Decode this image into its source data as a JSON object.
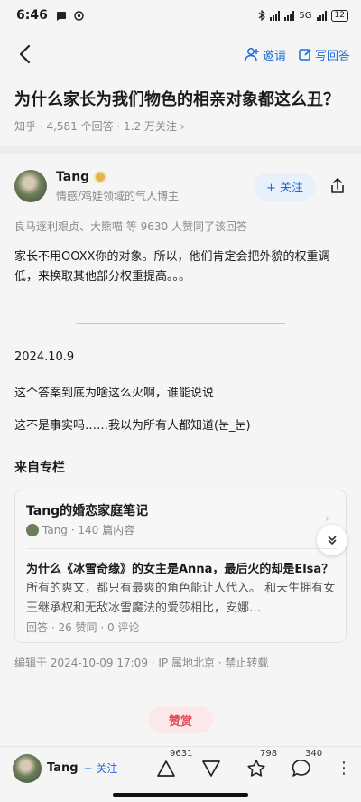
{
  "status_bar": {
    "time": "6:46",
    "network": "5G",
    "battery": "12"
  },
  "nav": {
    "invite_label": "邀请",
    "write_answer_label": "写回答"
  },
  "question": {
    "title": "为什么家长为我们物色的相亲对象都这么丑？",
    "meta": "知乎 · 4,581 个回答 · 1.2 万关注 ›"
  },
  "author": {
    "name": "Tang",
    "description": "情感/鸡娃领域的气人博主",
    "follow_label": "+ 关注"
  },
  "answer": {
    "upvoters": "良马逐利艰贞、大熊喵 等 9630 人赞同了该回答",
    "paragraph1": "家长不用OOXX你的对象。所以，他们肯定会把外貌的权重调低，来换取其他部分权重提高。。。",
    "date": "2024.10.9",
    "paragraph2": "这个答案到底为啥这么火啊，谁能说说",
    "paragraph3": "这不是事实吗……我以为所有人都知道(눈_눈)"
  },
  "column": {
    "section_title": "来自专栏",
    "title": "Tang的婚恋家庭笔记",
    "meta": "Tang · 140 篇内容",
    "article_title": "为什么《冰雪奇缘》的女主是Anna，最后火的却是Elsa？",
    "article_excerpt": "所有的爽文，都只有最爽的角色能让人代入。 和天生拥有女王继承权和无敌冰雪魔法的爱莎相比，安娜…",
    "article_meta": "回答 · 26 赞同 · 0 评论"
  },
  "edit_info": "编辑于 2024-10-09 17:09 · IP 属地北京 · 禁止转载",
  "reward_label": "赞赏",
  "bottom_bar": {
    "author_name": "Tang",
    "follow_label": "+ 关注",
    "upvote_count": "9631",
    "favorite_count": "798",
    "comment_count": "340"
  },
  "icons": {
    "back": "back-arrow-icon",
    "invite": "add-user-icon",
    "write": "edit-icon",
    "share": "share-icon",
    "upvote": "upvote-triangle-icon",
    "downvote": "downvote-triangle-icon",
    "favorite": "star-icon",
    "comment": "comment-bubble-icon",
    "more": "more-vertical-icon"
  },
  "colors": {
    "accent": "#1e6bd6",
    "reward": "#e0475b",
    "reward_bg": "#fbe9e9"
  }
}
